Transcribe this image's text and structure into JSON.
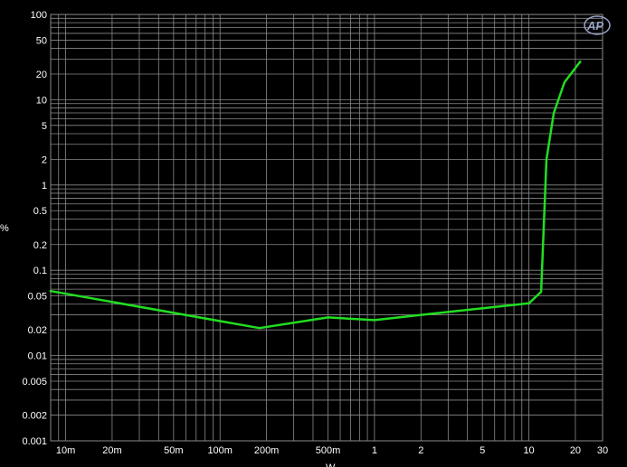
{
  "chart_data": {
    "type": "line",
    "title": "",
    "xlabel": "W",
    "ylabel": "%",
    "x_scale": "log",
    "y_scale": "log",
    "xlim": [
      0.008,
      30
    ],
    "ylim": [
      0.001,
      100
    ],
    "grid": true,
    "x_ticks": [
      {
        "value": 0.01,
        "label": "10m"
      },
      {
        "value": 0.02,
        "label": "20m"
      },
      {
        "value": 0.05,
        "label": "50m"
      },
      {
        "value": 0.1,
        "label": "100m"
      },
      {
        "value": 0.2,
        "label": "200m"
      },
      {
        "value": 0.5,
        "label": "500m"
      },
      {
        "value": 1,
        "label": "1"
      },
      {
        "value": 2,
        "label": "2"
      },
      {
        "value": 5,
        "label": "5"
      },
      {
        "value": 10,
        "label": "10"
      },
      {
        "value": 20,
        "label": "20"
      },
      {
        "value": 30,
        "label": "30"
      }
    ],
    "y_ticks": [
      {
        "value": 100,
        "label": "100"
      },
      {
        "value": 50,
        "label": "50"
      },
      {
        "value": 20,
        "label": "20"
      },
      {
        "value": 10,
        "label": "10"
      },
      {
        "value": 5,
        "label": "5"
      },
      {
        "value": 2,
        "label": "2"
      },
      {
        "value": 1,
        "label": "1"
      },
      {
        "value": 0.5,
        "label": "0.5"
      },
      {
        "value": 0.2,
        "label": "0.2"
      },
      {
        "value": 0.1,
        "label": "0.1"
      },
      {
        "value": 0.05,
        "label": "0.05"
      },
      {
        "value": 0.02,
        "label": "0.02"
      },
      {
        "value": 0.01,
        "label": "0.01"
      },
      {
        "value": 0.005,
        "label": "0.005"
      },
      {
        "value": 0.002,
        "label": "0.002"
      },
      {
        "value": 0.001,
        "label": "0.001"
      }
    ],
    "series": [
      {
        "color": "#ff2020",
        "x": [
          0.008,
          0.18,
          0.5,
          1.0,
          2.0,
          10.0,
          12.0,
          13.0,
          14.5,
          17.0,
          21.5
        ],
        "y": [
          0.057,
          0.021,
          0.028,
          0.026,
          0.03,
          0.041,
          0.056,
          2.0,
          7.0,
          16.0,
          28.0
        ]
      },
      {
        "color": "#22dd22",
        "x": [
          0.008,
          0.18,
          0.5,
          1.0,
          2.0,
          10.0,
          12.0,
          13.0,
          14.5,
          17.0,
          21.5
        ],
        "y": [
          0.057,
          0.021,
          0.028,
          0.026,
          0.03,
          0.041,
          0.056,
          2.0,
          7.0,
          16.0,
          28.0
        ]
      }
    ]
  },
  "logo": {
    "text": "AP",
    "color": "#9aa4c8"
  },
  "colors": {
    "background": "#000000",
    "grid": "#8a8a8a",
    "text": "#ffffff"
  }
}
